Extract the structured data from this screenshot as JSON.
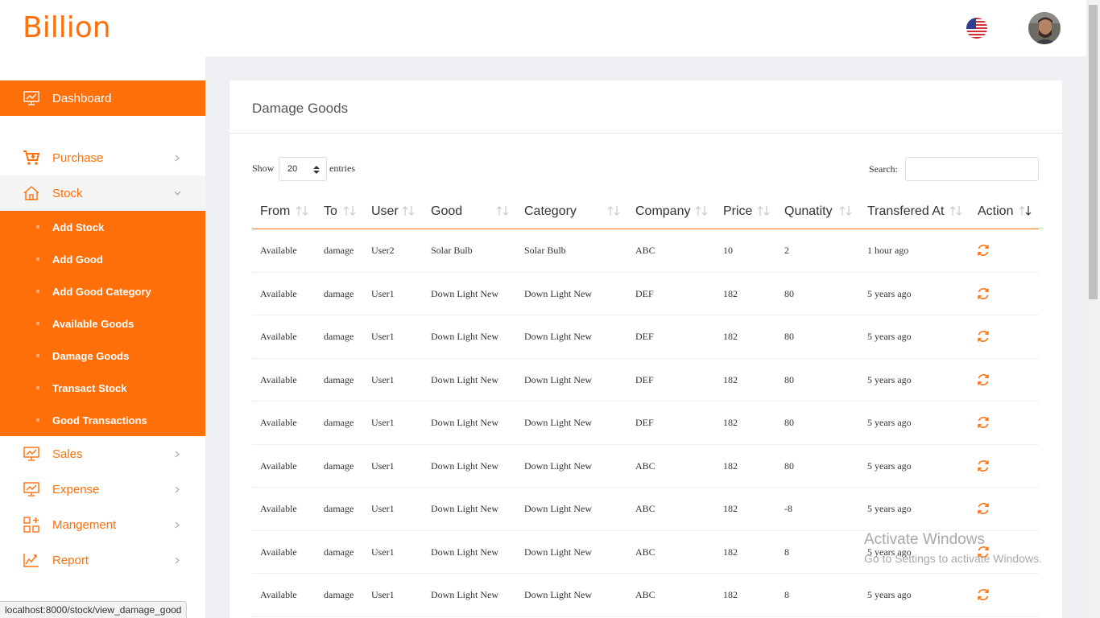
{
  "brand": {
    "name": "Billion",
    "color": "#ff6f0a"
  },
  "topbar": {
    "language_icon": "us-flag-icon",
    "avatar_icon": "user-avatar"
  },
  "sidebar": {
    "dashboard": {
      "label": "Dashboard",
      "icon": "chart-monitor-icon"
    },
    "purchase": {
      "label": "Purchase",
      "icon": "cart-plus-icon"
    },
    "stock": {
      "label": "Stock",
      "icon": "home-icon"
    },
    "stock_items": [
      {
        "label": "Add Stock"
      },
      {
        "label": "Add Good"
      },
      {
        "label": "Add Good Category"
      },
      {
        "label": "Available Goods"
      },
      {
        "label": "Damage Goods"
      },
      {
        "label": "Transact Stock"
      },
      {
        "label": "Good Transactions"
      }
    ],
    "sales": {
      "label": "Sales",
      "icon": "chart-monitor-icon"
    },
    "expense": {
      "label": "Expense",
      "icon": "chart-monitor-icon"
    },
    "management": {
      "label": "Mangement",
      "icon": "grid-plus-icon"
    },
    "report": {
      "label": "Report",
      "icon": "line-chart-icon"
    }
  },
  "main": {
    "title": "Damage Goods",
    "show_label": "Show",
    "entries_value": "20",
    "entries_label": "entries",
    "search_label": "Search:",
    "search_value": "",
    "columns": [
      "From",
      "To",
      "User",
      "Good",
      "Category",
      "Company",
      "Price",
      "Qunatity",
      "Transfered At",
      "Action"
    ],
    "rows": [
      [
        "Available",
        "damage",
        "User2",
        "Solar Bulb",
        "Solar Bulb",
        "ABC",
        "10",
        "2",
        "1 hour ago"
      ],
      [
        "Available",
        "damage",
        "User1",
        "Down Light New",
        "Down Light New",
        "DEF",
        "182",
        "80",
        "5 years ago"
      ],
      [
        "Available",
        "damage",
        "User1",
        "Down Light New",
        "Down Light New",
        "DEF",
        "182",
        "80",
        "5 years ago"
      ],
      [
        "Available",
        "damage",
        "User1",
        "Down Light New",
        "Down Light New",
        "DEF",
        "182",
        "80",
        "5 years ago"
      ],
      [
        "Available",
        "damage",
        "User1",
        "Down Light New",
        "Down Light New",
        "DEF",
        "182",
        "80",
        "5 years ago"
      ],
      [
        "Available",
        "damage",
        "User1",
        "Down Light New",
        "Down Light New",
        "ABC",
        "182",
        "80",
        "5 years ago"
      ],
      [
        "Available",
        "damage",
        "User1",
        "Down Light New",
        "Down Light New",
        "ABC",
        "182",
        "-8",
        "5 years ago"
      ],
      [
        "Available",
        "damage",
        "User1",
        "Down Light New",
        "Down Light New",
        "ABC",
        "182",
        "8",
        "5 years ago"
      ],
      [
        "Available",
        "damage",
        "User1",
        "Down Light New",
        "Down Light New",
        "ABC",
        "182",
        "8",
        "5 years ago"
      ]
    ]
  },
  "watermark": {
    "line1": "Activate Windows",
    "line2": "Go to Settings to activate Windows."
  },
  "status_url": "localhost:8000/stock/view_damage_good"
}
